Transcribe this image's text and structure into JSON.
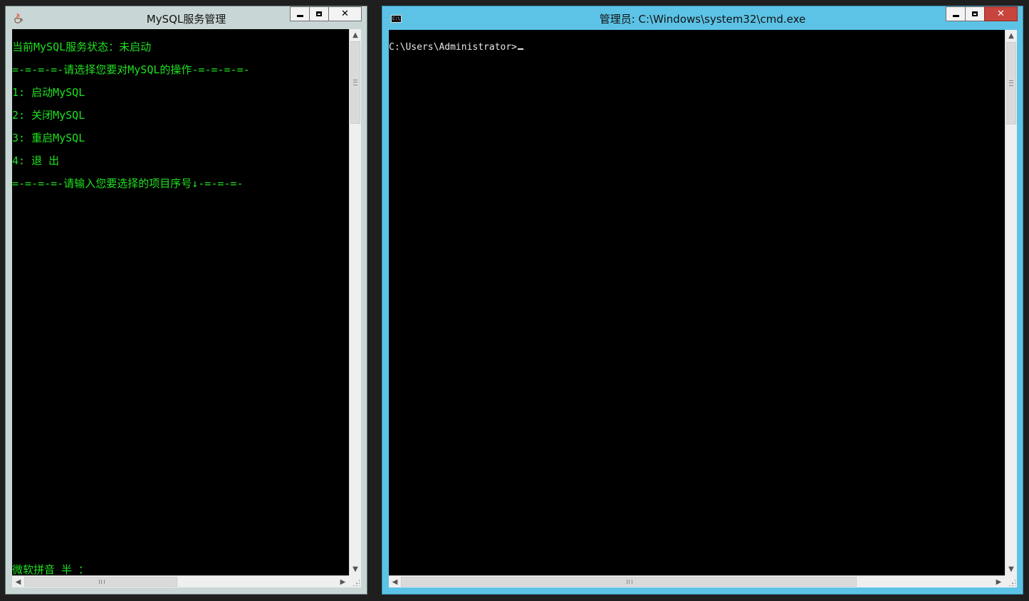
{
  "windows": [
    {
      "title": "MySQL服务管理",
      "icon": "java-cup-icon",
      "lines": [
        "当前MySQL服务状态：未启动",
        "=-=-=-=-请选择您要对MySQL的操作-=-=-=-=-",
        "1: 启动MySQL",
        "2: 关闭MySQL",
        "3: 重启MySQL",
        "4: 退 出",
        "=-=-=-=-请输入您要选择的项目序号↓-=-=-=-"
      ],
      "ime_status": "微软拼音 半 ：",
      "text_color": "#1fe21f"
    },
    {
      "title": "管理员: C:\\Windows\\system32\\cmd.exe",
      "icon": "cmd-icon",
      "prompt": "C:\\Users\\Administrator>",
      "text_color": "#e8e8e8",
      "titlebar_color": "#5cc3e6"
    }
  ],
  "controls": {
    "minimize": "minimize-icon",
    "maximize": "maximize-icon",
    "close": "✕"
  },
  "scrollbar": {
    "up": "▲",
    "down": "▼",
    "left": "◀",
    "right": "▶"
  }
}
